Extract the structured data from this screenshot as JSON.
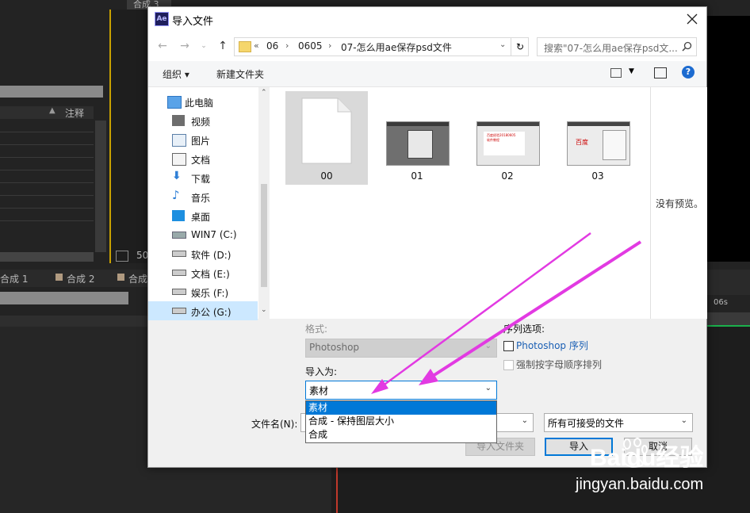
{
  "ae": {
    "tab_top": "合成 3",
    "header_note": "注释",
    "tabs": [
      "合成 1",
      "合成 2",
      "合成"
    ],
    "zoom": "50",
    "time_marker": "06s"
  },
  "dialog": {
    "title": "导入文件",
    "app_icon_text": "Ae",
    "breadcrumb": [
      "06",
      "0605",
      "07-怎么用ae保存psd文件"
    ],
    "breadcrumb_more": "«",
    "search_placeholder": "搜索\"07-怎么用ae保存psd文...",
    "toolbar": {
      "organize": "组织 ▾",
      "new_folder": "新建文件夹"
    },
    "tree": [
      {
        "label": "此电脑",
        "icon": "computer-icon"
      },
      {
        "label": "视频",
        "icon": "video-icon"
      },
      {
        "label": "图片",
        "icon": "pictures-icon"
      },
      {
        "label": "文档",
        "icon": "documents-icon"
      },
      {
        "label": "下载",
        "icon": "download-icon"
      },
      {
        "label": "音乐",
        "icon": "music-icon"
      },
      {
        "label": "桌面",
        "icon": "desktop-icon"
      },
      {
        "label": "WIN7 (C:)",
        "icon": "windows-drive-icon"
      },
      {
        "label": "软件 (D:)",
        "icon": "drive-icon"
      },
      {
        "label": "文档 (E:)",
        "icon": "drive-icon"
      },
      {
        "label": "娱乐 (F:)",
        "icon": "drive-icon"
      },
      {
        "label": "办公 (G:)",
        "icon": "drive-icon"
      }
    ],
    "files": [
      {
        "name": "00",
        "selected": true
      },
      {
        "name": "01",
        "selected": false
      },
      {
        "name": "02",
        "selected": false
      },
      {
        "name": "03",
        "selected": false
      }
    ],
    "thumb_02_text": "百度经验20180605\n软件教程",
    "thumb_03_text": "百度",
    "preview_text": "没有预览。",
    "format_label": "格式:",
    "format_value": "Photoshop",
    "sequence_label": "序列选项:",
    "photoshop_sequence": "Photoshop 序列",
    "alphabetical": "强制按字母顺序排列",
    "import_as_label": "导入为:",
    "import_as_value": "素材",
    "import_as_options": [
      "素材",
      "合成 - 保持图层大小",
      "合成"
    ],
    "filename_label": "文件名(N):",
    "filetype_value": "所有可接受的文件",
    "import_folder_btn": "导入文件夹",
    "import_btn": "导入",
    "cancel_btn": "取消"
  },
  "watermark": {
    "brand": "Baidu经验",
    "url": "jingyan.baidu.com"
  },
  "colors": {
    "accent": "#0078d7",
    "arrow": "#e040e0",
    "ae_bg": "#232323"
  }
}
